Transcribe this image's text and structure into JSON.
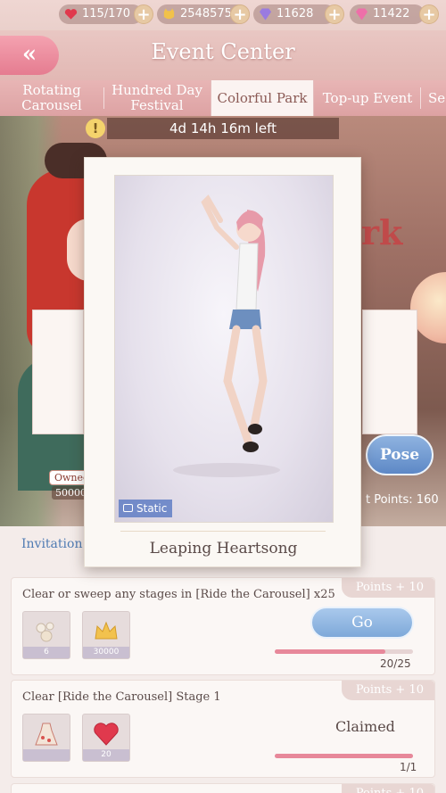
{
  "resources": {
    "stamina": "115/170",
    "gold": "2548575",
    "diamonds": "11628",
    "stardust": "11422"
  },
  "header": {
    "back_icon": "double-chevron-left-icon",
    "title": "Event Center"
  },
  "tabs": [
    {
      "label": "Rotating Carousel",
      "active": false
    },
    {
      "label": "Hundred Day Festival",
      "active": false
    },
    {
      "label": "Colorful Park",
      "active": true
    },
    {
      "label": "Top-up Event",
      "active": false
    },
    {
      "label": "Se",
      "active": false
    }
  ],
  "timer": "4d 14h 16m left",
  "background": {
    "banner_title": "rk",
    "owned_tag": "Owned",
    "owned_price": "50000",
    "pose_button": "Pose",
    "points_label": "t Points: 160"
  },
  "modal": {
    "item_name": "Leaping Heartsong",
    "static_tag": "Static"
  },
  "panel": {
    "tab_label": "Invitation",
    "tasks": [
      {
        "description": "Clear or sweep any stages in [Ride the Carousel] x25",
        "points": "Points + 10",
        "rewards": [
          {
            "icon": "pearl-accessory-icon",
            "qty": "6"
          },
          {
            "icon": "gold-crown-icon",
            "qty": "30000"
          }
        ],
        "action": "Go",
        "progress": "20/25",
        "progress_ratio": 0.8
      },
      {
        "description": "Clear [Ride the Carousel] Stage 1",
        "points": "Points + 10",
        "rewards": [
          {
            "icon": "floral-dress-icon",
            "qty": ""
          },
          {
            "icon": "heart-stamina-icon",
            "qty": "20"
          }
        ],
        "status": "Claimed",
        "progress": "1/1",
        "progress_ratio": 1.0
      },
      {
        "points": "Points + 10"
      }
    ]
  },
  "colors": {
    "accent_pink": "#e57c90",
    "go_blue": "#7ea9d9",
    "progress_fill": "#e7889a"
  }
}
